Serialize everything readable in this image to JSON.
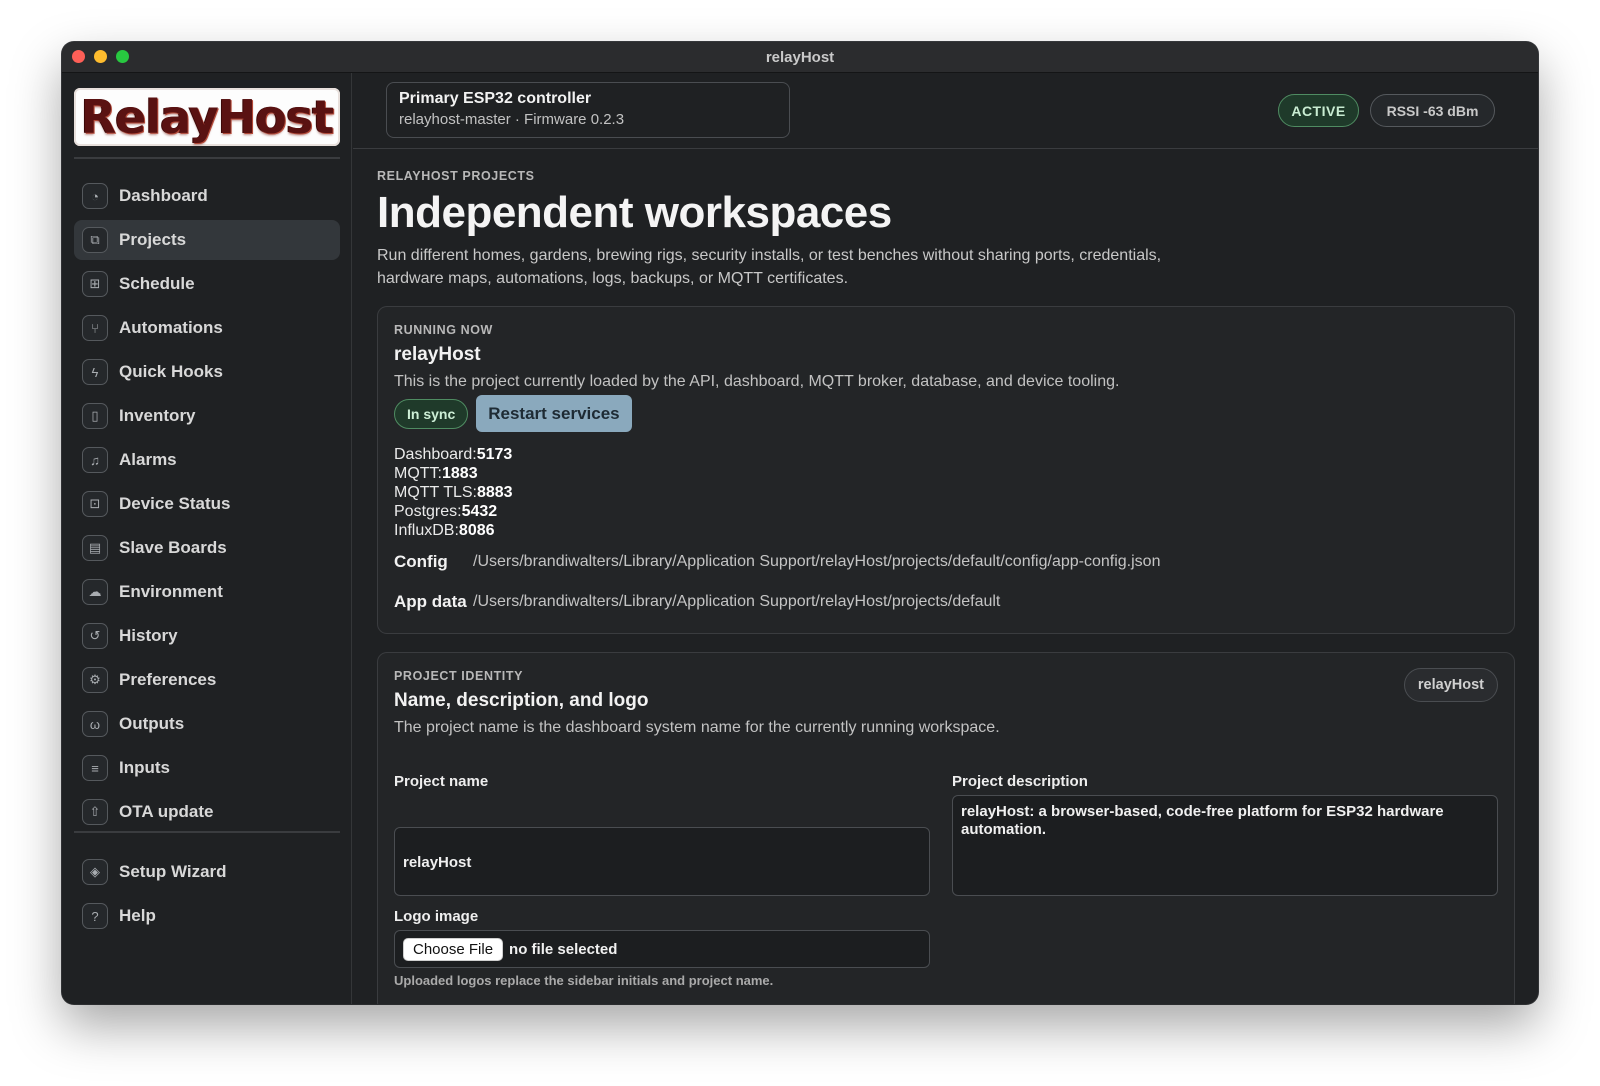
{
  "window": {
    "title": "relayHost"
  },
  "sidebar": {
    "logo_text": "RelayHost",
    "items": [
      {
        "label": "Dashboard",
        "icon": "dashboard-icon",
        "glyph": "◔",
        "active": false
      },
      {
        "label": "Projects",
        "icon": "projects-icon",
        "glyph": "⧉",
        "active": true
      },
      {
        "label": "Schedule",
        "icon": "schedule-icon",
        "glyph": "⊞",
        "active": false
      },
      {
        "label": "Automations",
        "icon": "automations-icon",
        "glyph": "⑂",
        "active": false
      },
      {
        "label": "Quick Hooks",
        "icon": "quick-hooks-icon",
        "glyph": "ϟ",
        "active": false
      },
      {
        "label": "Inventory",
        "icon": "inventory-icon",
        "glyph": "▯",
        "active": false
      },
      {
        "label": "Alarms",
        "icon": "alarm-bell-icon",
        "glyph": "♫",
        "active": false
      },
      {
        "label": "Device Status",
        "icon": "device-status-icon",
        "glyph": "⊡",
        "active": false
      },
      {
        "label": "Slave Boards",
        "icon": "slave-boards-icon",
        "glyph": "▤",
        "active": false
      },
      {
        "label": "Environment",
        "icon": "environment-icon",
        "glyph": "☁",
        "active": false
      },
      {
        "label": "History",
        "icon": "history-icon",
        "glyph": "↺",
        "active": false
      },
      {
        "label": "Preferences",
        "icon": "gear-icon",
        "glyph": "⚙",
        "active": false
      },
      {
        "label": "Outputs",
        "icon": "outputs-icon",
        "glyph": "ω",
        "active": false
      },
      {
        "label": "Inputs",
        "icon": "inputs-icon",
        "glyph": "≡",
        "active": false
      },
      {
        "label": "OTA update",
        "icon": "upload-icon",
        "glyph": "⇧",
        "active": false
      }
    ],
    "footer_items": [
      {
        "label": "Setup Wizard",
        "icon": "setup-wizard-icon",
        "glyph": "◈"
      },
      {
        "label": "Help",
        "icon": "help-icon",
        "glyph": "?"
      }
    ]
  },
  "topbar": {
    "device_name": "Primary ESP32 controller",
    "device_sub": "relayhost-master · Firmware 0.2.3",
    "status_badge": "ACTIVE",
    "rssi_badge": "RSSI -63 dBm"
  },
  "header": {
    "eyebrow": "RELAYHOST PROJECTS",
    "title": "Independent workspaces",
    "intro": "Run different homes, gardens, brewing rigs, security installs, or test benches without sharing ports, credentials, hardware maps, automations, logs, backups, or MQTT certificates."
  },
  "running": {
    "eyebrow": "RUNNING NOW",
    "title": "relayHost",
    "desc": "This is the project currently loaded by the API, dashboard, MQTT broker, database, and device tooling.",
    "sync_badge": "In sync",
    "restart_label": "Restart services",
    "ports": [
      {
        "label": "Dashboard:",
        "value": "5173"
      },
      {
        "label": "MQTT:",
        "value": "1883"
      },
      {
        "label": "MQTT TLS:",
        "value": "8883"
      },
      {
        "label": "Postgres:",
        "value": "5432"
      },
      {
        "label": "InfluxDB:",
        "value": "8086"
      }
    ],
    "config_label": "Config",
    "config_path": "/Users/brandiwalters/Library/Application Support/relayHost/projects/default/config/app-config.json",
    "appdata_label": "App data",
    "appdata_path": "/Users/brandiwalters/Library/Application Support/relayHost/projects/default"
  },
  "identity": {
    "eyebrow": "PROJECT IDENTITY",
    "title": "Name, description, and logo",
    "desc": "The project name is the dashboard system name for the currently running workspace.",
    "tag": "relayHost",
    "name_label": "Project name",
    "name_value": "relayHost",
    "description_label": "Project description",
    "description_value": "relayHost: a browser-based, code-free platform for ESP32 hardware automation.",
    "logo_label": "Logo image",
    "file_button": "Choose File",
    "file_status": "no file selected",
    "hint": "Uploaded logos replace the sidebar initials and project name."
  }
}
